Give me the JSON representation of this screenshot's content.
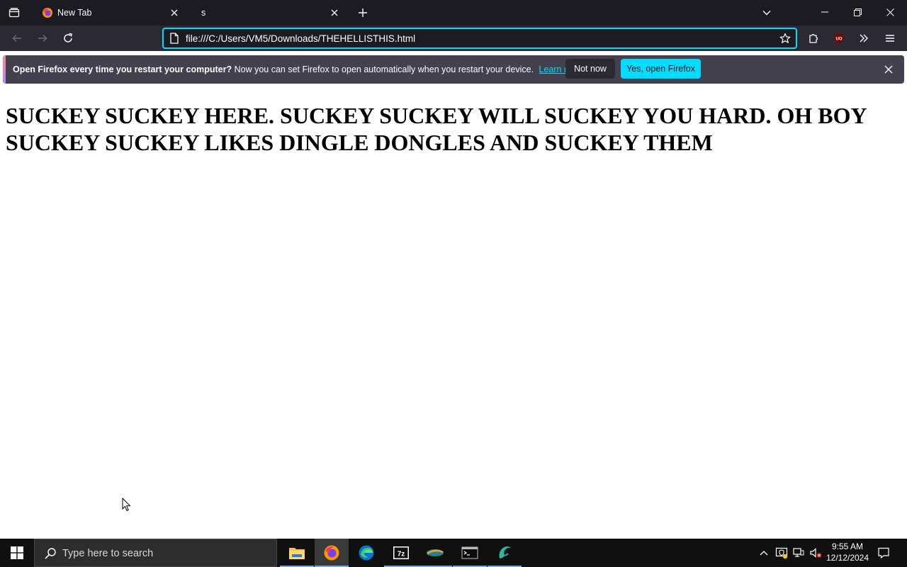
{
  "browser": {
    "tabs": [
      {
        "label": "New Tab",
        "icon": "firefox-icon"
      },
      {
        "label": "s"
      }
    ],
    "url": "file:///C:/Users/VM5/Downloads/THEHELLISTHIS.html"
  },
  "notification": {
    "bold_text": "Open Firefox every time you restart your computer?",
    "text": "Now you can set Firefox to open automatically when you restart your device.",
    "link": "Learn more",
    "not_now": "Not now",
    "yes": "Yes, open Firefox"
  },
  "page": {
    "heading": "SUCKEY SUCKEY HERE. SUCKEY SUCKEY WILL SUCKEY YOU HARD. OH BOY SUCKEY SUCKEY LIKES DINGLE DONGLES AND SUCKEY THEM"
  },
  "taskbar": {
    "search_placeholder": "Type here to search",
    "apps": [
      "file-explorer-icon",
      "firefox-icon",
      "edge-icon",
      "7zip-icon",
      "app-icon",
      "terminal-icon",
      "wireshark-icon"
    ],
    "time": "9:55 AM",
    "date": "12/12/2024"
  },
  "colors": {
    "accent": "#00ddff",
    "toolbar": "#2b2a33",
    "tabstrip": "#1c1b22"
  }
}
